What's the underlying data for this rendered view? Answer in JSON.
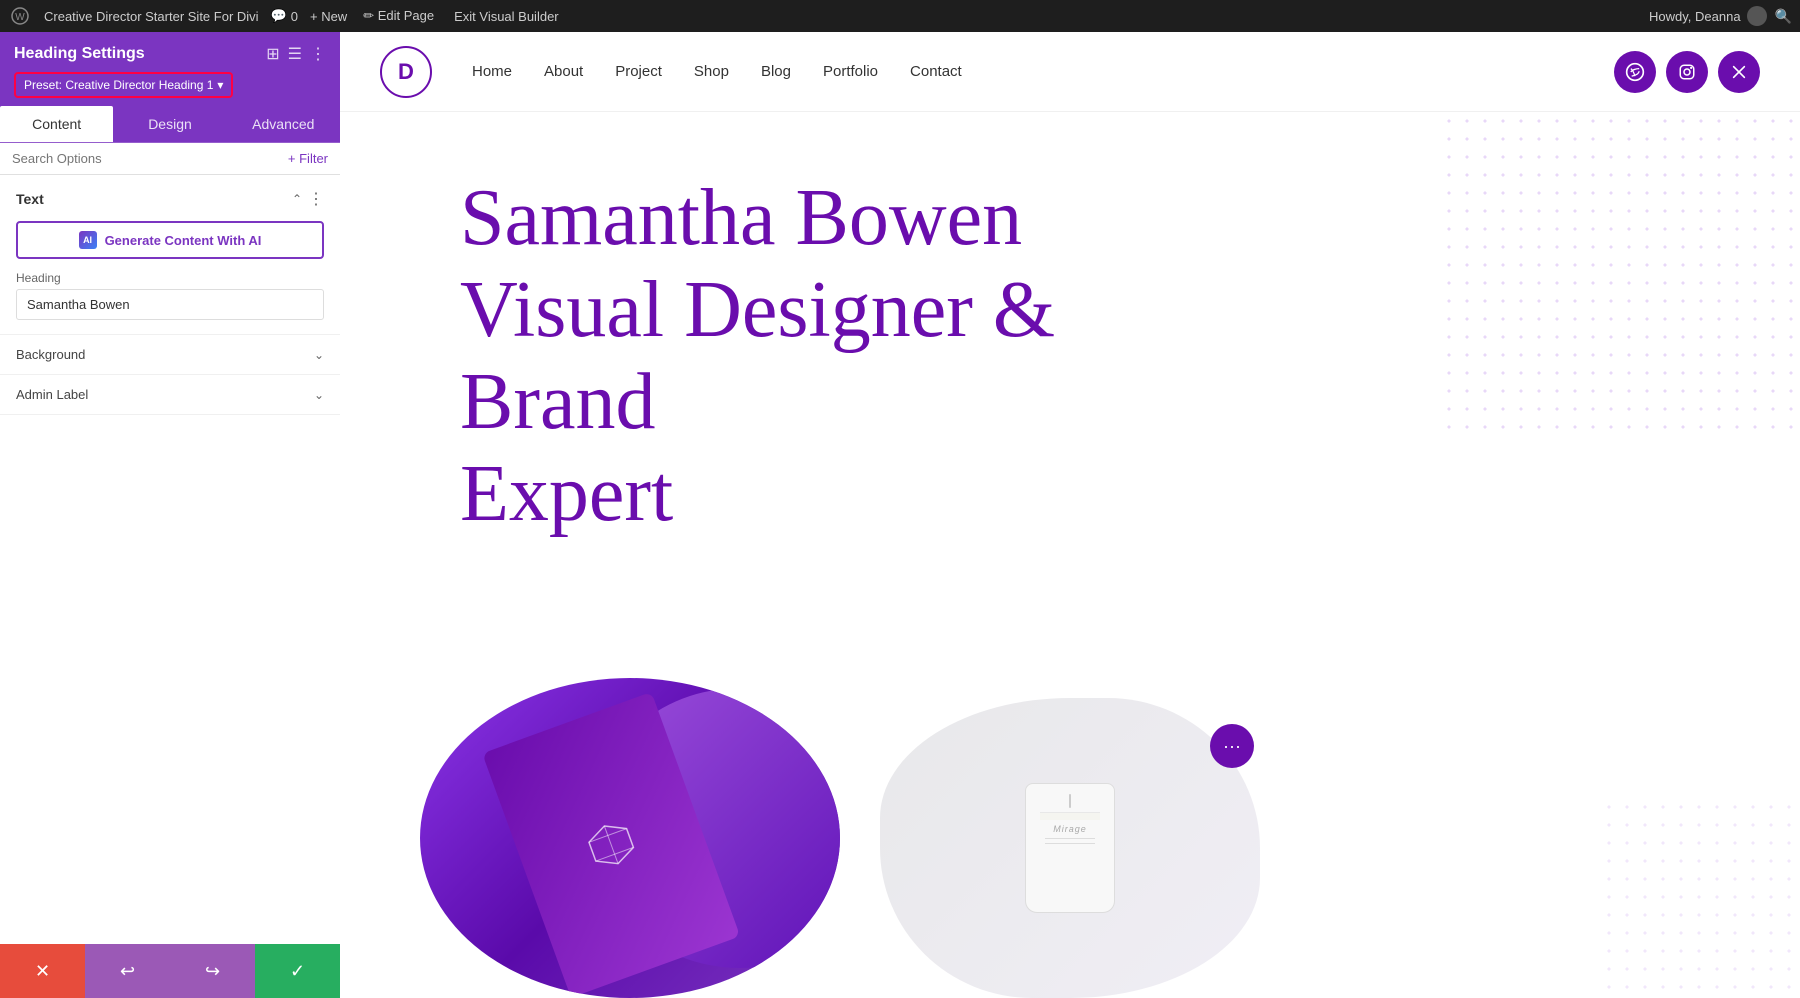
{
  "admin_bar": {
    "wp_icon": "⊞",
    "site_name": "Creative Director Starter Site For Divi",
    "comments_icon": "💬",
    "comments_count": "0",
    "new_label": "+ New",
    "edit_page_label": "✏ Edit Page",
    "exit_builder_label": "Exit Visual Builder",
    "howdy_label": "Howdy, Deanna",
    "search_icon": "🔍"
  },
  "panel": {
    "title": "Heading Settings",
    "icon_expand": "⊞",
    "icon_columns": "☰",
    "icon_more": "⋮",
    "preset_label": "Preset: Creative Director Heading 1",
    "preset_dropdown": "▾",
    "tabs": [
      "Content",
      "Design",
      "Advanced"
    ],
    "active_tab": "Content",
    "search_placeholder": "Search Options",
    "filter_label": "+ Filter",
    "text_section": {
      "title": "Text",
      "collapse_icon": "⌃",
      "more_icon": "⋮",
      "ai_button_label": "Generate Content With AI",
      "ai_icon_label": "AI",
      "heading_field_label": "Heading",
      "heading_value": "Samantha Bowen"
    },
    "background_section": {
      "title": "Background",
      "chevron": "⌄"
    },
    "admin_label_section": {
      "title": "Admin Label",
      "chevron": "⌄"
    },
    "bottom_buttons": {
      "cancel": "✕",
      "undo": "↩",
      "redo": "↪",
      "save": "✓"
    }
  },
  "site": {
    "logo_letter": "D",
    "nav_links": [
      "Home",
      "About",
      "Project",
      "Shop",
      "Blog",
      "Portfolio",
      "Contact"
    ],
    "social_icons": [
      "✿",
      "📷",
      "✕"
    ],
    "hero_heading_line1": "Samantha Bowen",
    "hero_heading_line2": "Visual Designer & Brand",
    "hero_heading_line3": "Expert",
    "candle_brand": "Mirage",
    "floating_more": "•••"
  }
}
